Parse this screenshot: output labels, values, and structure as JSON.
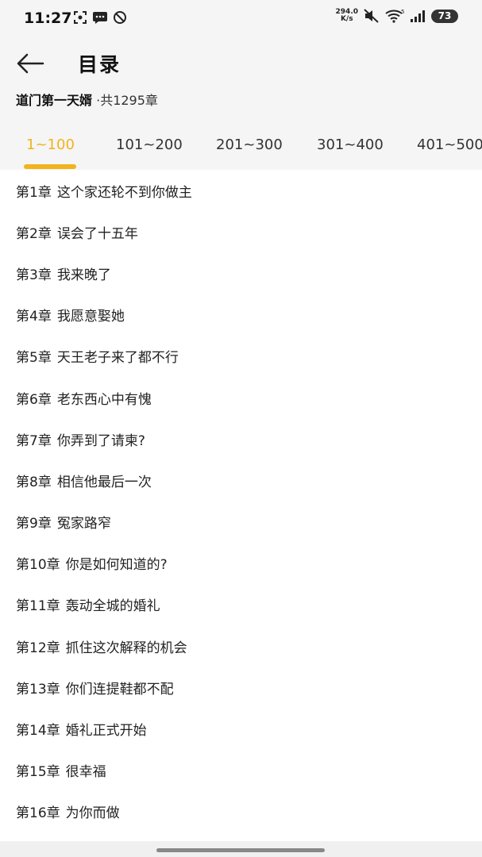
{
  "status_bar": {
    "time": "11:27",
    "net_speed_value": "294.0",
    "net_speed_unit": "K/s",
    "battery": "73"
  },
  "header": {
    "title": "目录"
  },
  "book": {
    "name": "道门第一天婿",
    "count": " ·共1295章"
  },
  "tabs": [
    "1~100",
    "101~200",
    "201~300",
    "301~400",
    "401~500"
  ],
  "chapters": [
    {
      "num": "第1章",
      "title": "这个家还轮不到你做主"
    },
    {
      "num": "第2章",
      "title": "误会了十五年"
    },
    {
      "num": "第3章",
      "title": "我来晚了"
    },
    {
      "num": "第4章",
      "title": "我愿意娶她"
    },
    {
      "num": "第5章",
      "title": "天王老子来了都不行"
    },
    {
      "num": "第6章",
      "title": "老东西心中有愧"
    },
    {
      "num": "第7章",
      "title": "你弄到了请柬?"
    },
    {
      "num": "第8章",
      "title": "相信他最后一次"
    },
    {
      "num": "第9章",
      "title": "冤家路窄"
    },
    {
      "num": "第10章",
      "title": "你是如何知道的?"
    },
    {
      "num": "第11章",
      "title": "轰动全城的婚礼"
    },
    {
      "num": "第12章",
      "title": "抓住这次解释的机会"
    },
    {
      "num": "第13章",
      "title": "你们连提鞋都不配"
    },
    {
      "num": "第14章",
      "title": "婚礼正式开始"
    },
    {
      "num": "第15章",
      "title": "很幸福"
    },
    {
      "num": "第16章",
      "title": "为你而做"
    }
  ],
  "colors": {
    "accent": "#f2b31c"
  }
}
